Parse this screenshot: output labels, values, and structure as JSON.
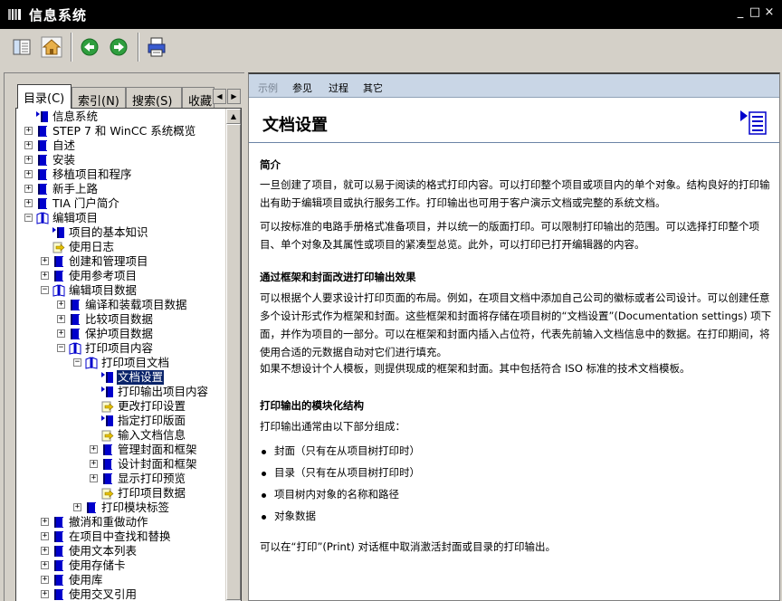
{
  "window": {
    "title": "信息系统",
    "minimize_glyph": "_",
    "restore_glyph": "□",
    "close_glyph": "×"
  },
  "toolbar": {
    "buttons": [
      {
        "icon": "hide-toc-icon"
      },
      {
        "icon": "home-icon"
      },
      {
        "icon": "back-icon"
      },
      {
        "icon": "forward-icon"
      },
      {
        "icon": "print-icon"
      }
    ]
  },
  "nav": {
    "tabs": [
      {
        "label": "目录(C)"
      },
      {
        "label": "索引(N)"
      },
      {
        "label": "搜索(S)"
      },
      {
        "label": "收藏"
      }
    ],
    "tree": [
      {
        "label": "信息系统",
        "level": 0,
        "icon": "topic-book",
        "exp": ""
      },
      {
        "label": "STEP 7 和 WinCC 系统概览",
        "level": 0,
        "icon": "book",
        "exp": "+"
      },
      {
        "label": "自述",
        "level": 0,
        "icon": "book",
        "exp": "+"
      },
      {
        "label": "安装",
        "level": 0,
        "icon": "book",
        "exp": "+"
      },
      {
        "label": "移植项目和程序",
        "level": 0,
        "icon": "book",
        "exp": "+"
      },
      {
        "label": "新手上路",
        "level": 0,
        "icon": "book",
        "exp": "+"
      },
      {
        "label": "TIA 门户简介",
        "level": 0,
        "icon": "book",
        "exp": "+"
      },
      {
        "label": "编辑项目",
        "level": 0,
        "icon": "open-book",
        "exp": "-"
      },
      {
        "label": "项目的基本知识",
        "level": 1,
        "icon": "topic-book",
        "exp": ""
      },
      {
        "label": "使用日志",
        "level": 1,
        "icon": "topic-link",
        "exp": ""
      },
      {
        "label": "创建和管理项目",
        "level": 1,
        "icon": "book",
        "exp": "+"
      },
      {
        "label": "使用参考项目",
        "level": 1,
        "icon": "book",
        "exp": "+"
      },
      {
        "label": "编辑项目数据",
        "level": 1,
        "icon": "open-book",
        "exp": "-"
      },
      {
        "label": "编译和装载项目数据",
        "level": 2,
        "icon": "book",
        "exp": "+"
      },
      {
        "label": "比较项目数据",
        "level": 2,
        "icon": "book",
        "exp": "+"
      },
      {
        "label": "保护项目数据",
        "level": 2,
        "icon": "book",
        "exp": "+"
      },
      {
        "label": "打印项目内容",
        "level": 2,
        "icon": "open-book",
        "exp": "-"
      },
      {
        "label": "打印项目文档",
        "level": 3,
        "icon": "open-book",
        "exp": "-"
      },
      {
        "label": "文档设置",
        "level": 4,
        "icon": "topic-book",
        "exp": "",
        "selected": true
      },
      {
        "label": "打印输出项目内容",
        "level": 4,
        "icon": "topic-book",
        "exp": ""
      },
      {
        "label": "更改打印设置",
        "level": 4,
        "icon": "topic-link",
        "exp": ""
      },
      {
        "label": "指定打印版面",
        "level": 4,
        "icon": "topic-book",
        "exp": ""
      },
      {
        "label": "输入文档信息",
        "level": 4,
        "icon": "topic-link",
        "exp": ""
      },
      {
        "label": "管理封面和框架",
        "level": 4,
        "icon": "book",
        "exp": "+"
      },
      {
        "label": "设计封面和框架",
        "level": 4,
        "icon": "book",
        "exp": "+"
      },
      {
        "label": "显示打印预览",
        "level": 4,
        "icon": "book",
        "exp": "+"
      },
      {
        "label": "打印项目数据",
        "level": 4,
        "icon": "topic-link",
        "exp": ""
      },
      {
        "label": "打印模块标签",
        "level": 3,
        "icon": "book",
        "exp": "+"
      },
      {
        "label": "撤消和重做动作",
        "level": 1,
        "icon": "book",
        "exp": "+"
      },
      {
        "label": "在项目中查找和替换",
        "level": 1,
        "icon": "book",
        "exp": "+"
      },
      {
        "label": "使用文本列表",
        "level": 1,
        "icon": "book",
        "exp": "+"
      },
      {
        "label": "使用存储卡",
        "level": 1,
        "icon": "book",
        "exp": "+"
      },
      {
        "label": "使用库",
        "level": 1,
        "icon": "book",
        "exp": "+"
      },
      {
        "label": "使用交叉引用",
        "level": 1,
        "icon": "book",
        "exp": "+"
      }
    ]
  },
  "content": {
    "links": [
      {
        "label": "示例",
        "disabled": true
      },
      {
        "label": "参见",
        "disabled": false
      },
      {
        "label": "过程",
        "disabled": false
      },
      {
        "label": "其它",
        "disabled": false
      }
    ],
    "title": "文档设置",
    "h1": "简介",
    "p1": "一旦创建了项目，就可以易于阅读的格式打印内容。可以打印整个项目或项目内的单个对象。结构良好的打印输出有助于编辑项目或执行服务工作。打印输出也可用于客户演示文档或完整的系统文档。",
    "p2": "可以按标准的电路手册格式准备项目，并以统一的版面打印。可以限制打印输出的范围。可以选择打印整个项目、单个对象及其属性或项目的紧凑型总览。此外，可以打印已打开编辑器的内容。",
    "h2": "通过框架和封面改进打印输出效果",
    "p3": "可以根据个人要求设计打印页面的布局。例如，在项目文档中添加自己公司的徽标或者公司设计。可以创建任意多个设计形式作为框架和封面。这些框架和封面将存储在项目树的“文档设置”(Documentation settings) 项下面，并作为项目的一部分。可以在框架和封面内插入占位符，代表先前输入文档信息中的数据。在打印期间，将使用合适的元数据自动对它们进行填充。",
    "p4": "如果不想设计个人模板，则提供现成的框架和封面。其中包括符合 ISO 标准的技术文档模板。",
    "h3": "打印输出的模块化结构",
    "p5": "打印输出通常由以下部分组成：",
    "bullets": [
      "封面（只有在从项目树打印时）",
      "目录（只有在从项目树打印时）",
      "项目树内对象的名称和路径",
      "对象数据"
    ],
    "p6": "可以在“打印”(Print) 对话框中取消激活封面或目录的打印输出。"
  },
  "colors": {
    "titlebar": "#000000",
    "book_blue": "#0000cc",
    "link_bar": "#c9d6e6",
    "selection": "#0a246a"
  }
}
